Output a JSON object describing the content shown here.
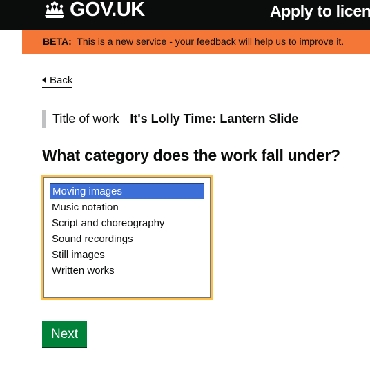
{
  "header": {
    "logo_text": "GOV.UK",
    "logo_icon": "crown-icon",
    "service_name": "Apply to licen"
  },
  "beta_banner": {
    "tag": "BETA:",
    "text_before": "This is a new service - your",
    "link_text": "feedback",
    "text_after": "will help us to improve it."
  },
  "back_link": {
    "label": "Back",
    "icon": "back-arrow-icon"
  },
  "summary": {
    "label": "Title of work",
    "value": "It's Lolly Time: Lantern Slide"
  },
  "question": "What category does the work fall under?",
  "category_select": {
    "selected": "Moving images",
    "options": [
      "Moving images",
      "Music notation",
      "Script and choreography",
      "Sound recordings",
      "Still images",
      "Written works"
    ]
  },
  "next_button": {
    "label": "Next"
  },
  "colors": {
    "header_bg": "#0b0c0c",
    "beta_bg": "#f47738",
    "focus": "#ffbf47",
    "selected_option": "#3c6fd8",
    "button": "#00823b"
  }
}
